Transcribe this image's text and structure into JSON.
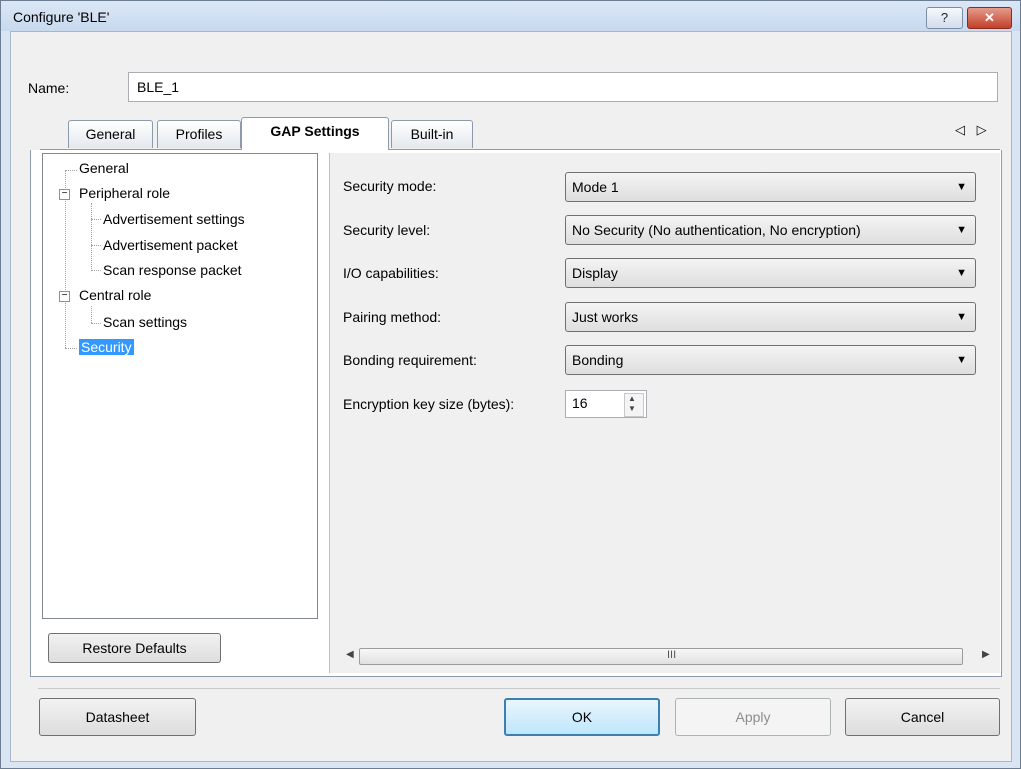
{
  "window": {
    "title": "Configure 'BLE'",
    "help_label": "?",
    "close_label": "✕"
  },
  "name": {
    "label": "Name:",
    "value": "BLE_1"
  },
  "tabs": [
    {
      "label": "General"
    },
    {
      "label": "Profiles"
    },
    {
      "label": "GAP Settings"
    },
    {
      "label": "Built-in"
    }
  ],
  "tab_scroll": "◁ ▷",
  "tree": {
    "items": [
      {
        "label": "General"
      },
      {
        "label": "Peripheral role"
      },
      {
        "label": "Advertisement settings"
      },
      {
        "label": "Advertisement packet"
      },
      {
        "label": "Scan response packet"
      },
      {
        "label": "Central role"
      },
      {
        "label": "Scan settings"
      },
      {
        "label": "Security"
      }
    ],
    "selected": "Security"
  },
  "restore_label": "Restore Defaults",
  "settings": [
    {
      "label": "Security mode:",
      "value": "Mode 1"
    },
    {
      "label": "Security level:",
      "value": "No Security (No authentication, No encryption)"
    },
    {
      "label": "I/O capabilities:",
      "value": "Display"
    },
    {
      "label": "Pairing method:",
      "value": "Just works"
    },
    {
      "label": "Bonding requirement:",
      "value": "Bonding"
    }
  ],
  "key_size": {
    "label": "Encryption key size (bytes):",
    "value": "16"
  },
  "scroll": {
    "left_arrow": "◀",
    "right_arrow": "▶",
    "grip": "III"
  },
  "buttons": {
    "datasheet": "Datasheet",
    "ok": "OK",
    "apply": "Apply",
    "cancel": "Cancel"
  },
  "icons": {
    "dropdown": "dropdown-arrow-icon",
    "expander": "collapse-icon"
  }
}
